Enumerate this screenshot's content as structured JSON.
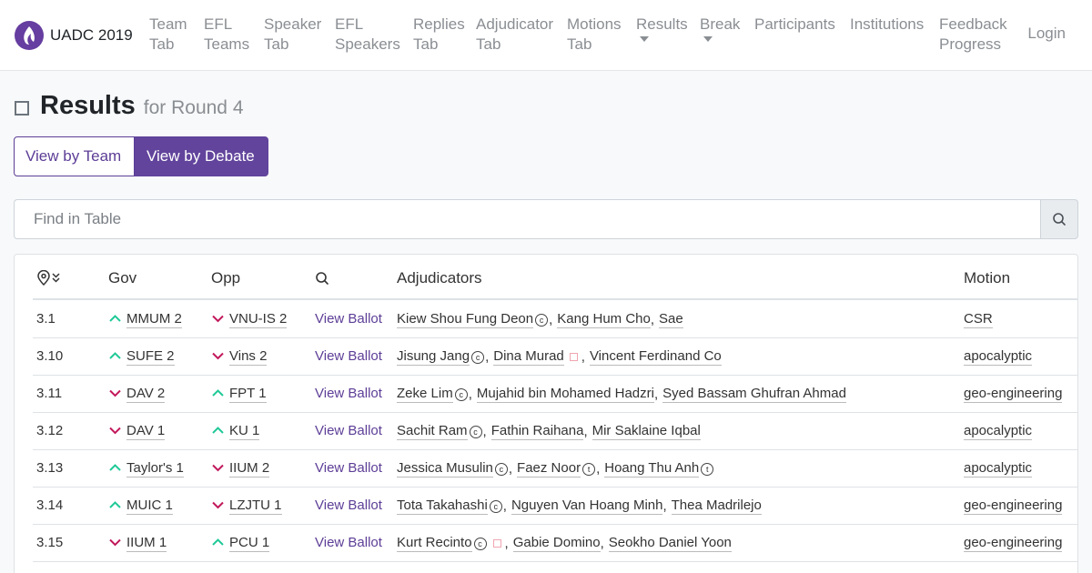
{
  "brand": {
    "name": "UADC 2019"
  },
  "nav": {
    "items": [
      {
        "label": "Team\nTab",
        "dropdown": false
      },
      {
        "label": "EFL\nTeams",
        "dropdown": false
      },
      {
        "label": "Speaker\nTab",
        "dropdown": false
      },
      {
        "label": "EFL\nSpeakers",
        "dropdown": false
      },
      {
        "label": "Replies\nTab",
        "dropdown": false
      },
      {
        "label": "Adjudicator\nTab",
        "dropdown": false
      },
      {
        "label": "Motions\nTab",
        "dropdown": false
      },
      {
        "label": "Results",
        "dropdown": true
      },
      {
        "label": "Break",
        "dropdown": true
      },
      {
        "label": "Participants",
        "dropdown": false
      },
      {
        "label": "Institutions",
        "dropdown": false
      },
      {
        "label": "Feedback\nProgress",
        "dropdown": false
      }
    ],
    "login": "Login"
  },
  "header": {
    "title": "Results",
    "subtitle": "for Round 4"
  },
  "toggle": {
    "by_team": "View by Team",
    "by_debate": "View by Debate",
    "active": "by_debate"
  },
  "search": {
    "placeholder": "Find in Table"
  },
  "table": {
    "columns": {
      "venue_icon": "venue-sort-icon",
      "gov": "Gov",
      "opp": "Opp",
      "ballot_icon": "search-icon",
      "adjudicators": "Adjudicators",
      "motion": "Motion"
    },
    "colors": {
      "win": "#20c997",
      "loss": "#c2185b",
      "accent": "#62449c"
    },
    "rows": [
      {
        "id": "3.1",
        "gov": "MMUM 2",
        "gov_result": "win",
        "opp": "VNU-IS 2",
        "opp_result": "loss",
        "ballot": "View Ballot",
        "adjs": [
          {
            "name": "Kiew Shou Fung Deon",
            "mark": "c"
          },
          {
            "name": "Kang Hum Cho",
            "mark": ""
          },
          {
            "name": "Sae",
            "mark": ""
          }
        ],
        "motion": "CSR"
      },
      {
        "id": "3.10",
        "gov": "SUFE 2",
        "gov_result": "win",
        "opp": "Vins 2",
        "opp_result": "loss",
        "ballot": "View Ballot",
        "adjs": [
          {
            "name": "Jisung Jang",
            "mark": "c"
          },
          {
            "name": "Dina Murad",
            "mark": "flag"
          },
          {
            "name": "Vincent Ferdinand Co",
            "mark": ""
          }
        ],
        "motion": "apocalyptic"
      },
      {
        "id": "3.11",
        "gov": "DAV 2",
        "gov_result": "loss",
        "opp": "FPT 1",
        "opp_result": "win",
        "ballot": "View Ballot",
        "adjs": [
          {
            "name": "Zeke Lim",
            "mark": "c"
          },
          {
            "name": "Mujahid bin Mohamed Hadzri",
            "mark": ""
          },
          {
            "name": "Syed Bassam Ghufran Ahmad",
            "mark": ""
          }
        ],
        "motion": "geo-engineering"
      },
      {
        "id": "3.12",
        "gov": "DAV 1",
        "gov_result": "loss",
        "opp": "KU 1",
        "opp_result": "win",
        "ballot": "View Ballot",
        "adjs": [
          {
            "name": "Sachit Ram",
            "mark": "c"
          },
          {
            "name": "Fathin Raihana",
            "mark": ""
          },
          {
            "name": "Mir Saklaine Iqbal",
            "mark": ""
          }
        ],
        "motion": "apocalyptic"
      },
      {
        "id": "3.13",
        "gov": "Taylor's 1",
        "gov_result": "win",
        "opp": "IIUM 2",
        "opp_result": "loss",
        "ballot": "View Ballot",
        "adjs": [
          {
            "name": "Jessica Musulin",
            "mark": "c"
          },
          {
            "name": "Faez Noor",
            "mark": "t"
          },
          {
            "name": "Hoang Thu Anh",
            "mark": "t"
          }
        ],
        "motion": "apocalyptic"
      },
      {
        "id": "3.14",
        "gov": "MUIC 1",
        "gov_result": "win",
        "opp": "LZJTU 1",
        "opp_result": "loss",
        "ballot": "View Ballot",
        "adjs": [
          {
            "name": "Tota Takahashi",
            "mark": "c"
          },
          {
            "name": "Nguyen Van Hoang Minh",
            "mark": ""
          },
          {
            "name": "Thea Madrilejo",
            "mark": ""
          }
        ],
        "motion": "geo-engineering"
      },
      {
        "id": "3.15",
        "gov": "IIUM 1",
        "gov_result": "loss",
        "opp": "PCU 1",
        "opp_result": "win",
        "ballot": "View Ballot",
        "adjs": [
          {
            "name": "Kurt Recinto",
            "mark": "c+flag"
          },
          {
            "name": "Gabie Domino",
            "mark": ""
          },
          {
            "name": "Seokho Daniel Yoon",
            "mark": ""
          }
        ],
        "motion": "geo-engineering"
      }
    ]
  }
}
